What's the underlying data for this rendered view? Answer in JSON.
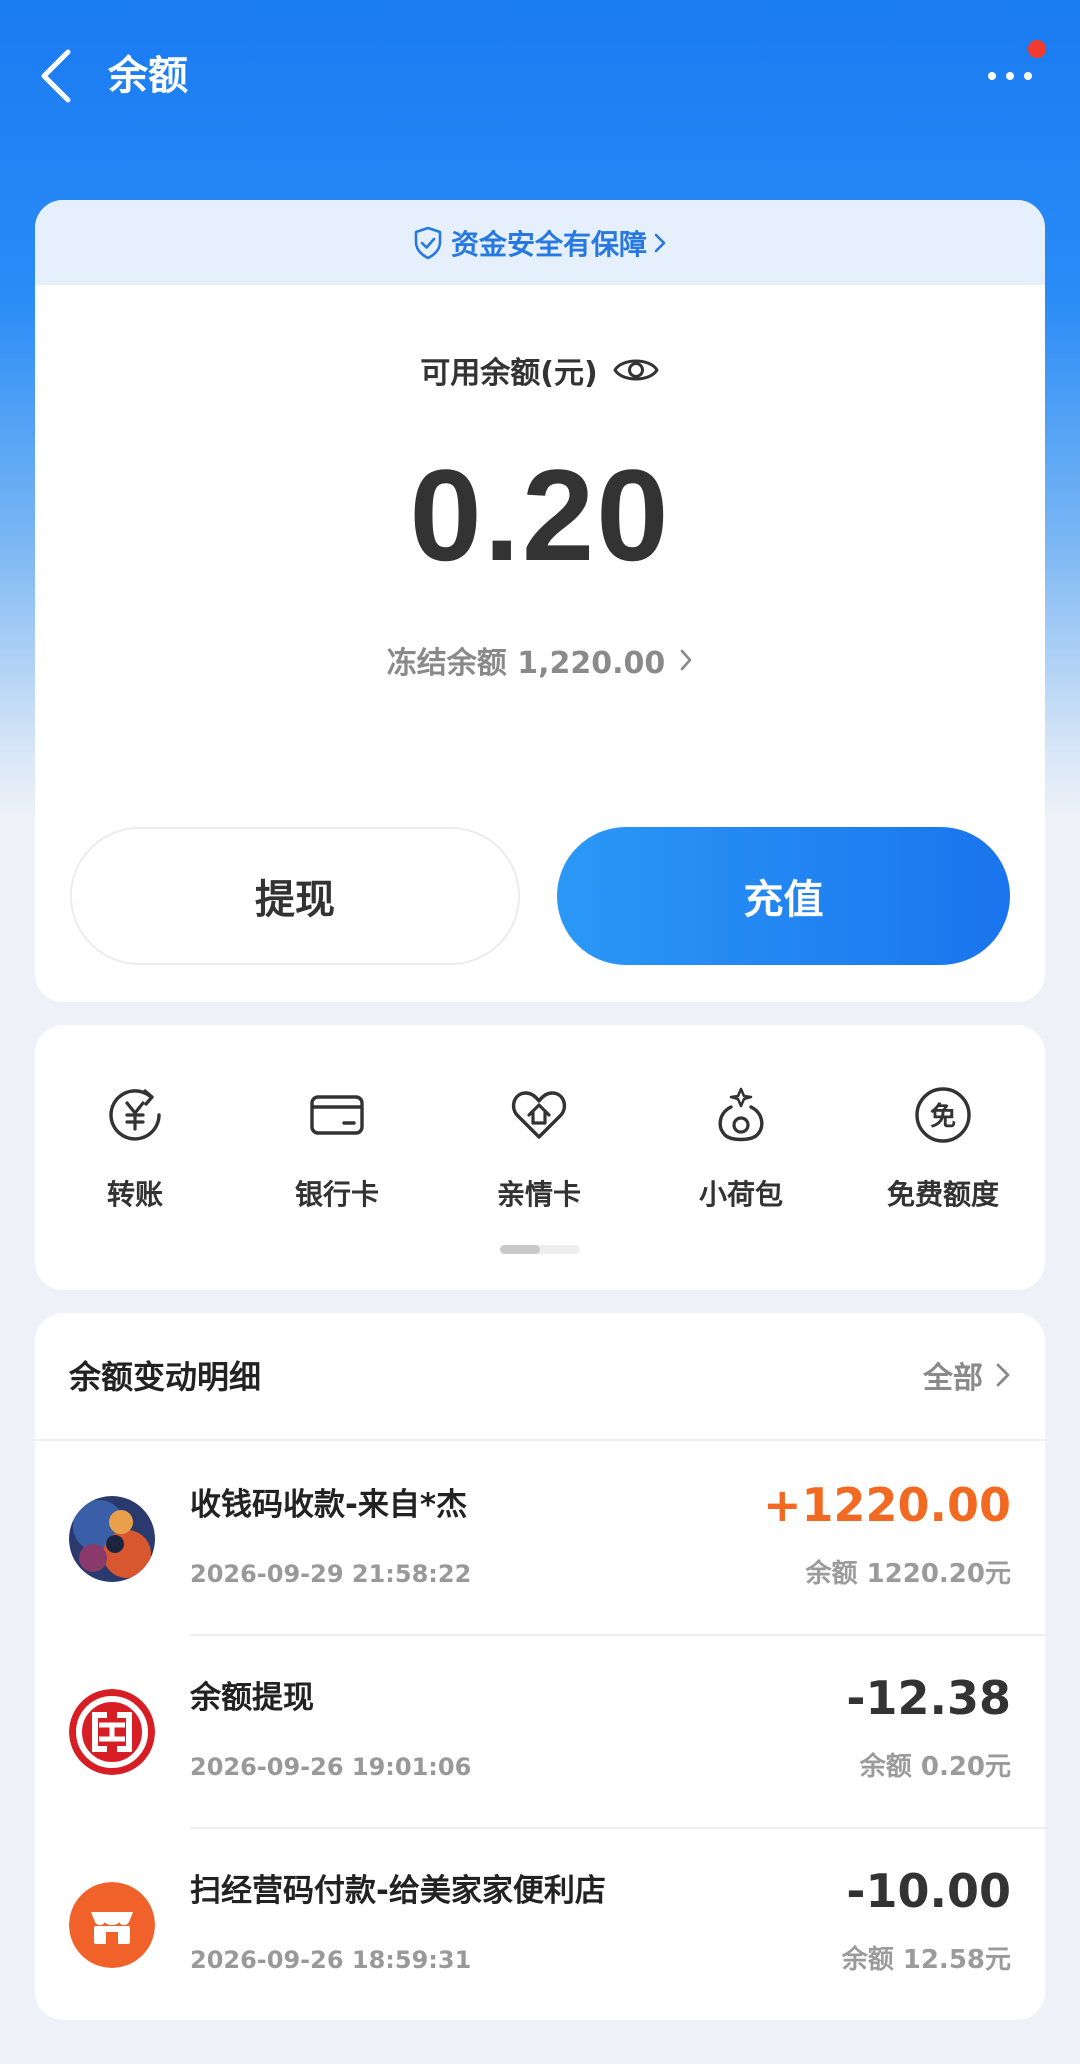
{
  "header": {
    "title": "余额"
  },
  "safety": {
    "label": "资金安全有保障"
  },
  "balance": {
    "label": "可用余额(元)",
    "amount": "0.20",
    "frozen_label": "冻结余额 1,220.00"
  },
  "buttons": {
    "withdraw": "提现",
    "topup": "充值"
  },
  "shortcuts": [
    {
      "label": "转账",
      "icon": "transfer-icon"
    },
    {
      "label": "银行卡",
      "icon": "bank-card-icon"
    },
    {
      "label": "亲情卡",
      "icon": "family-card-icon"
    },
    {
      "label": "小荷包",
      "icon": "purse-icon"
    },
    {
      "label": "免费额度",
      "icon": "free-quota-icon"
    }
  ],
  "shortcut_scroll_position": 0.5,
  "transactions": {
    "title": "余额变动明细",
    "all_label": "全部",
    "items": [
      {
        "name": "收钱码收款-来自*杰",
        "time": "2026-09-29 21:58:22",
        "amount": "+1220.00",
        "balance": "余额 1220.20元",
        "avatar": "user-avatar"
      },
      {
        "name": "余额提现",
        "time": "2026-09-26 19:01:06",
        "amount": "-12.38",
        "balance": "余额 0.20元",
        "avatar": "icbc-logo"
      },
      {
        "name": "扫经营码付款-给美家家便利店",
        "time": "2026-09-26 18:59:31",
        "amount": "-10.00",
        "balance": "余额 12.58元",
        "avatar": "store-icon"
      }
    ]
  },
  "colors": {
    "accent": "#1a74ee",
    "positive_amount": "#f26a21",
    "notification_dot": "#f23b2e"
  }
}
